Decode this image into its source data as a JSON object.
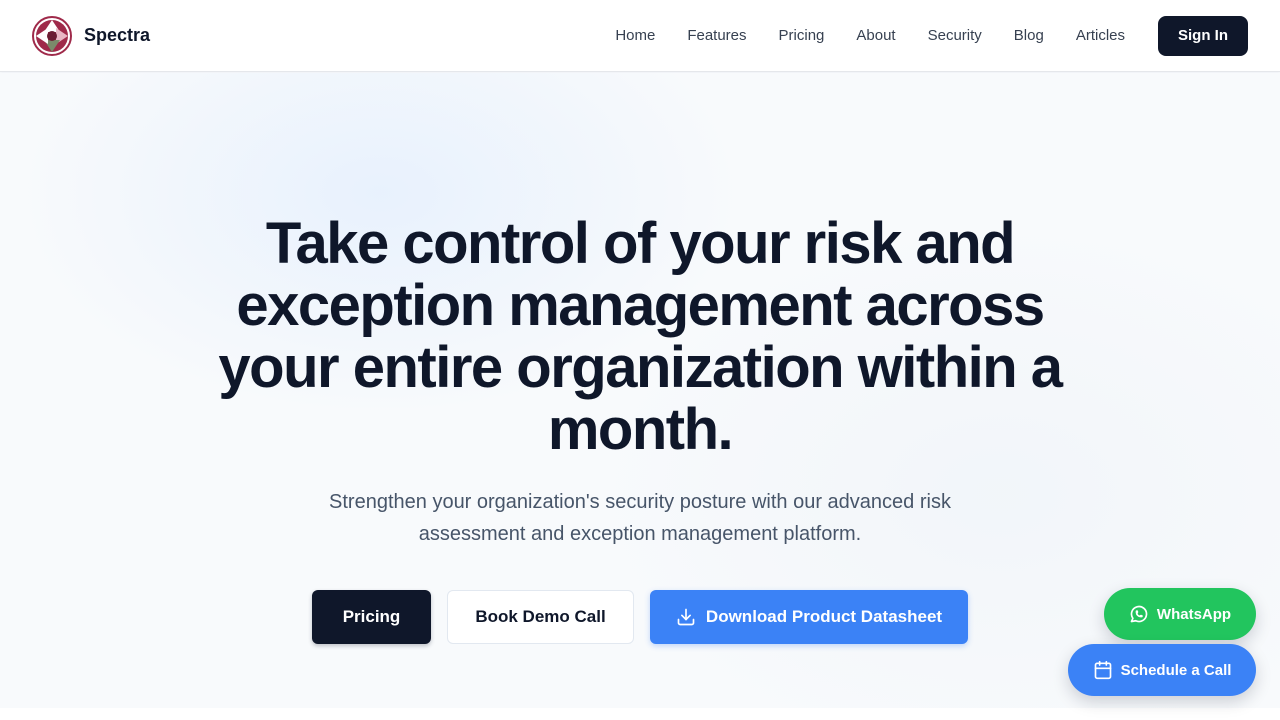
{
  "brand": {
    "name": "Spectra",
    "logo_icon": "aperture-logo-icon",
    "accent_color": "#9f2a4a"
  },
  "nav": {
    "items": [
      {
        "label": "Home"
      },
      {
        "label": "Features"
      },
      {
        "label": "Pricing"
      },
      {
        "label": "About"
      },
      {
        "label": "Security"
      },
      {
        "label": "Blog"
      },
      {
        "label": "Articles"
      }
    ],
    "signin_label": "Sign In"
  },
  "hero": {
    "title": "Take control of your risk and exception management across your entire organization within a month.",
    "subtitle": "Strengthen your organization's security posture with our advanced risk assessment and exception management platform.",
    "buttons": {
      "pricing_label": "Pricing",
      "demo_label": "Book Demo Call",
      "datasheet_label": "Download Product Datasheet",
      "datasheet_icon": "download-icon"
    }
  },
  "floating": {
    "whatsapp_label": "WhatsApp",
    "whatsapp_icon": "whatsapp-icon",
    "whatsapp_color": "#22c55e",
    "schedule_label": "Schedule a Call",
    "schedule_icon": "calendar-icon",
    "schedule_color": "#3b82f6"
  },
  "colors": {
    "primary_dark": "#0f172a",
    "primary_blue": "#3b82f6"
  }
}
